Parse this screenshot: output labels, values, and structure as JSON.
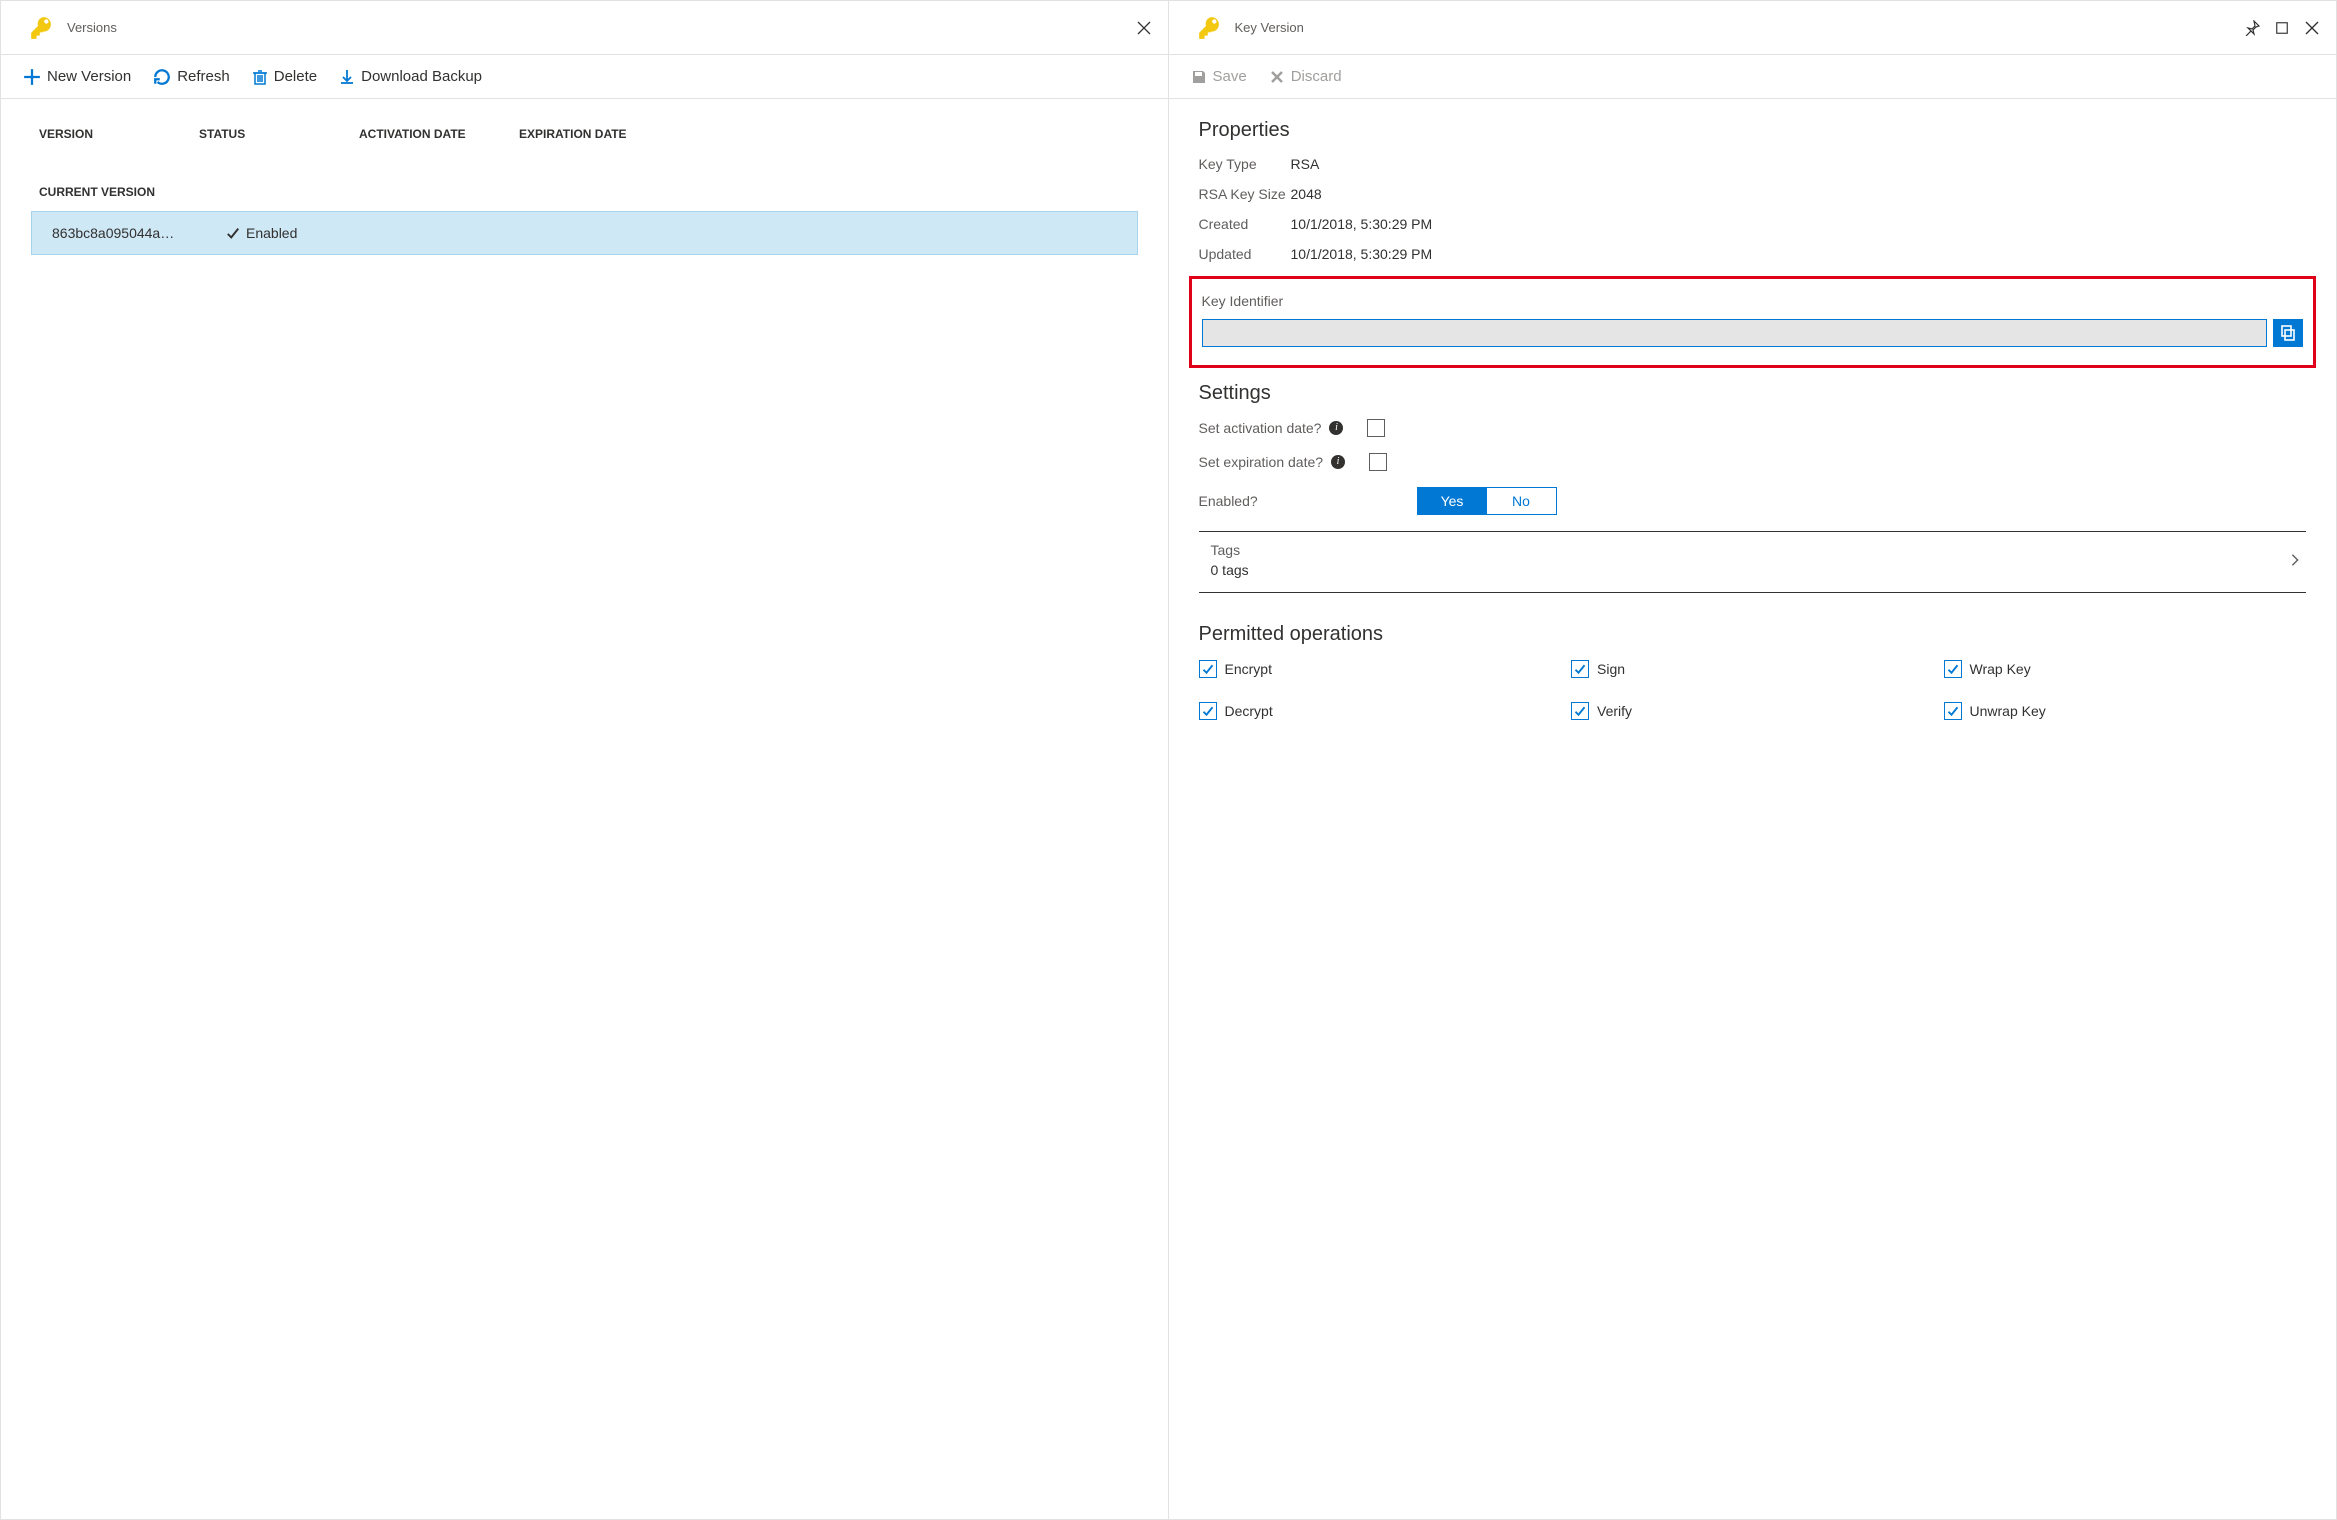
{
  "left": {
    "title": "Versions",
    "toolbar": {
      "new_version": "New Version",
      "refresh": "Refresh",
      "delete": "Delete",
      "download_backup": "Download Backup"
    },
    "columns": {
      "version": "VERSION",
      "status": "STATUS",
      "activation": "ACTIVATION DATE",
      "expiration": "EXPIRATION DATE"
    },
    "current_version_label": "CURRENT VERSION",
    "row": {
      "version": "863bc8a095044a…",
      "status": "Enabled"
    }
  },
  "right": {
    "title": "Key Version",
    "toolbar": {
      "save": "Save",
      "discard": "Discard"
    },
    "properties": {
      "heading": "Properties",
      "key_type_label": "Key Type",
      "key_type_value": "RSA",
      "rsa_size_label": "RSA Key Size",
      "rsa_size_value": "2048",
      "created_label": "Created",
      "created_value": "10/1/2018, 5:30:29 PM",
      "updated_label": "Updated",
      "updated_value": "10/1/2018, 5:30:29 PM",
      "key_identifier_label": "Key Identifier",
      "key_identifier_value": ""
    },
    "settings": {
      "heading": "Settings",
      "activation_label": "Set activation date?",
      "expiration_label": "Set expiration date?",
      "enabled_label": "Enabled?",
      "yes": "Yes",
      "no": "No"
    },
    "tags": {
      "label": "Tags",
      "count": "0 tags"
    },
    "permitted": {
      "heading": "Permitted operations",
      "ops": [
        "Encrypt",
        "Sign",
        "Wrap Key",
        "Decrypt",
        "Verify",
        "Unwrap Key"
      ]
    }
  }
}
